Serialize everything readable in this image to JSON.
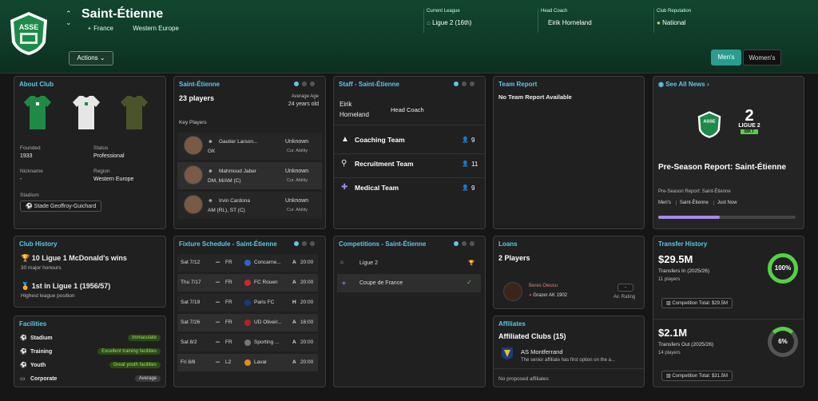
{
  "club": {
    "crest_text": "ASSE",
    "name": "Saint-Étienne",
    "country": "France",
    "region": "Western Europe",
    "actions_label": "Actions"
  },
  "header": {
    "league_label": "Current League",
    "league_value": "Ligue 2 (16th)",
    "coach_label": "Head Coach",
    "coach_value": "Eirik Horneland",
    "reputation_label": "Club Reputation",
    "reputation_value": "National"
  },
  "gender": {
    "mens": "Men's",
    "womens": "Women's"
  },
  "about": {
    "title": "About Club",
    "founded_label": "Founded",
    "founded": "1933",
    "status_label": "Status",
    "status": "Professional",
    "nickname_label": "Nickname",
    "nickname": "-",
    "region_label": "Region",
    "region": "Western Europe",
    "stadium_label": "Stadium",
    "stadium": "Stade Geoffroy-Guichard"
  },
  "squad": {
    "title": "Saint-Étienne",
    "players": "23 players",
    "avg_age_label": "Average Age",
    "avg_age": "24 years old",
    "key_label": "Key Players",
    "key_players": [
      {
        "name": "Gautier Larson...",
        "pos": "GK",
        "ability": "Unknown",
        "ability_label": "Cur. Ability"
      },
      {
        "name": "Mahmoud Jaber",
        "pos": "DM, M/AM (C)",
        "ability": "Unknown",
        "ability_label": "Cur. Ability"
      },
      {
        "name": "Irvin Cardona",
        "pos": "AM (RL), ST (C)",
        "ability": "Unknown",
        "ability_label": "Cur. Ability"
      }
    ]
  },
  "staff": {
    "title": "Staff - Saint-Étienne",
    "head_name_1": "Eirik",
    "head_name_2": "Horneland",
    "head_role": "Head Coach",
    "teams": [
      {
        "label": "Coaching Team",
        "count": "9"
      },
      {
        "label": "Recruitment Team",
        "count": "11"
      },
      {
        "label": "Medical Team",
        "count": "9"
      }
    ]
  },
  "report": {
    "title": "Team Report",
    "text": "No Team Report Available"
  },
  "news": {
    "title": "See All News",
    "league_num": "2",
    "league_name": "LIGUE 2",
    "league_sponsor": "BKT",
    "headline": "Pre-Season Report: Saint-Étienne",
    "sub": "Pre-Season Report: Saint-Étienne",
    "tags": [
      "Men's",
      "Saint-Étienne",
      "Just Now"
    ],
    "progress": 0.45
  },
  "history": {
    "title": "Club History",
    "wins": "10 Ligue 1 McDonald's wins",
    "honours": "30 major honours",
    "best": "1st in Ligue 1 (1956/57)",
    "best_sub": "Highest league position"
  },
  "facilities": {
    "title": "Facilities",
    "items": [
      {
        "label": "Stadium",
        "value": "Immaculate"
      },
      {
        "label": "Training",
        "value": "Excellent training facilities"
      },
      {
        "label": "Youth",
        "value": "Great youth facilities"
      },
      {
        "label": "Corporate",
        "value": "Average"
      }
    ]
  },
  "fixtures": {
    "title": "Fixture Schedule - Saint-Étienne",
    "rows": [
      {
        "date": "Sat 7/12",
        "comp": "FR",
        "team": "Concarne...",
        "venue": "A",
        "time": "20:00",
        "color": "#2a64c8"
      },
      {
        "date": "Thu 7/17",
        "comp": "FR",
        "team": "FC Rouen",
        "venue": "A",
        "time": "20:00",
        "color": "#c82a2a"
      },
      {
        "date": "Sat 7/19",
        "comp": "FR",
        "team": "Paris FC",
        "venue": "H",
        "time": "20:00",
        "color": "#1c3a7a"
      },
      {
        "date": "Sat 7/26",
        "comp": "FR",
        "team": "UD Oliveir...",
        "venue": "A",
        "time": "16:00",
        "color": "#b82020"
      },
      {
        "date": "Sat 8/2",
        "comp": "FR",
        "team": "Sporting ...",
        "venue": "A",
        "time": "20:00",
        "color": "#777777"
      },
      {
        "date": "Fri 8/8",
        "comp": "L2",
        "team": "Laval",
        "venue": "A",
        "time": "20:00",
        "color": "#e08a20"
      }
    ]
  },
  "competitions": {
    "title": "Competitions - Saint-Étienne",
    "items": [
      {
        "name": "Ligue 2"
      },
      {
        "name": "Coupe de France"
      }
    ]
  },
  "loans": {
    "title": "Loans",
    "count": "2 Players",
    "player": "Beres Owusu",
    "club": "Grazer AK 1902",
    "rating": "-",
    "rating_label": "Av. Rating"
  },
  "affiliates": {
    "title": "Affiliates",
    "heading": "Affiliated Clubs (15)",
    "club": "AS Montferrand",
    "desc": "The senior affiliate has first option on the a...",
    "none": "No proposed affiliates"
  },
  "transfers": {
    "title": "Transfer History",
    "in_amount": "$29.5M",
    "in_label": "Transfers In (2025/26)",
    "in_players": "11 players",
    "in_pct": "100%",
    "in_comp": "Competition Total:",
    "in_comp_val": "$29.5M",
    "out_amount": "$2.1M",
    "out_label": "Transfers Out (2025/26)",
    "out_players": "14 players",
    "out_pct": "6%",
    "out_comp": "Competition Total:",
    "out_comp_val": "$31.5M"
  },
  "colors": {
    "accent": "#5bc8e6",
    "green": "#56d047",
    "header": "#12462f"
  }
}
